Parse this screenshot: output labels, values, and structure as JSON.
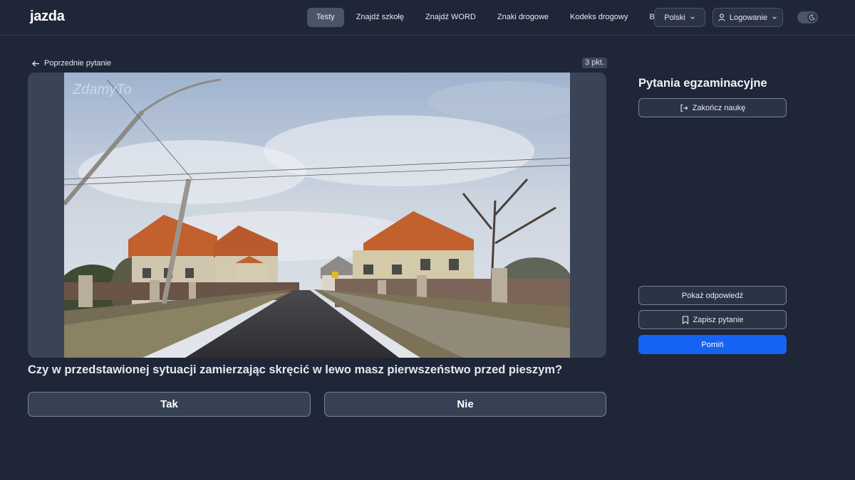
{
  "header": {
    "logo_text": "jazda",
    "nav": [
      "Testy",
      "Znajdź szkołę",
      "Znajdź WORD",
      "Znaki drogowe",
      "Kodeks drogowy",
      "Blog"
    ],
    "active_nav": "Testy",
    "language": "Polski",
    "login": "Logowanie",
    "theme_icon": "moon-icon"
  },
  "exam": {
    "back_label": "Poprzednie pytanie",
    "points": "3 pkt.",
    "watermark": "ZdamyTo",
    "question": "Czy w przedstawionej sytuacji zamierzając skręcić w lewo masz pierwszeństwo przed pieszym?",
    "answers": [
      "Tak",
      "Nie"
    ]
  },
  "sidebar": {
    "title": "Pytania egzaminacyjne",
    "finish": "Zakończ naukę",
    "show_answer": "Pokaż odpowiedź",
    "save_question": "Zapisz pytanie",
    "skip": "Pomiń"
  },
  "colors": {
    "background": "#1f2638",
    "accent": "#1463f3",
    "logo_accent": "#3b82f6"
  }
}
